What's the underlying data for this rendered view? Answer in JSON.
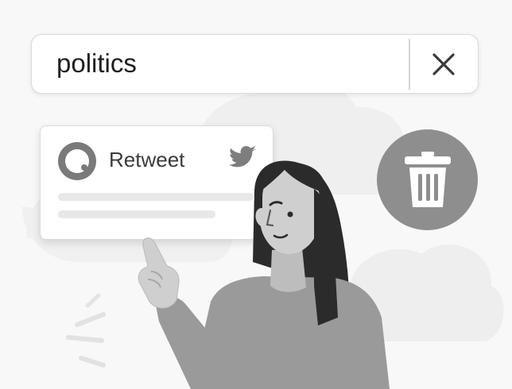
{
  "search": {
    "query": "politics"
  },
  "tweet_card": {
    "action_label": "Retweet"
  },
  "icons": {
    "clear": "close-icon",
    "bird": "bird-icon",
    "trash": "trash-icon",
    "avatar": "avatar-ring-icon"
  },
  "colors": {
    "background": "#f8f8f8",
    "card": "#ffffff",
    "trash_circle": "#8e8e8e",
    "hair": "#2b2b2b",
    "shirt": "#9a9a9a",
    "skin": "#cfcfcf"
  }
}
